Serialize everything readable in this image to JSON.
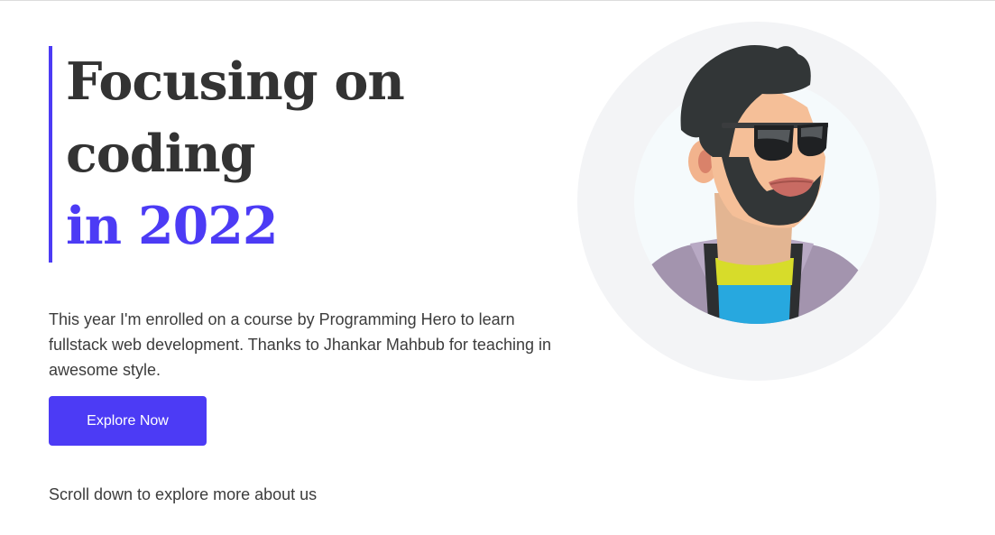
{
  "hero": {
    "title_line_1": "Focusing on",
    "title_line_2": "coding",
    "title_line_3": "in 2022",
    "description": "This year I'm enrolled on a course by Programming Hero to learn fullstack web development. Thanks to Jhankar Mahbub for teaching in awesome style.",
    "button_label": "Explore Now",
    "scroll_hint": "Scroll down to explore more about us"
  },
  "avatar": {
    "icon": "developer-avatar-illustration"
  },
  "colors": {
    "accent": "#4c3bf5",
    "heading": "#333333",
    "body_text": "#3c3c3c",
    "avatar_outer": "#f3f4f6",
    "avatar_inner": "#f5fafc"
  }
}
